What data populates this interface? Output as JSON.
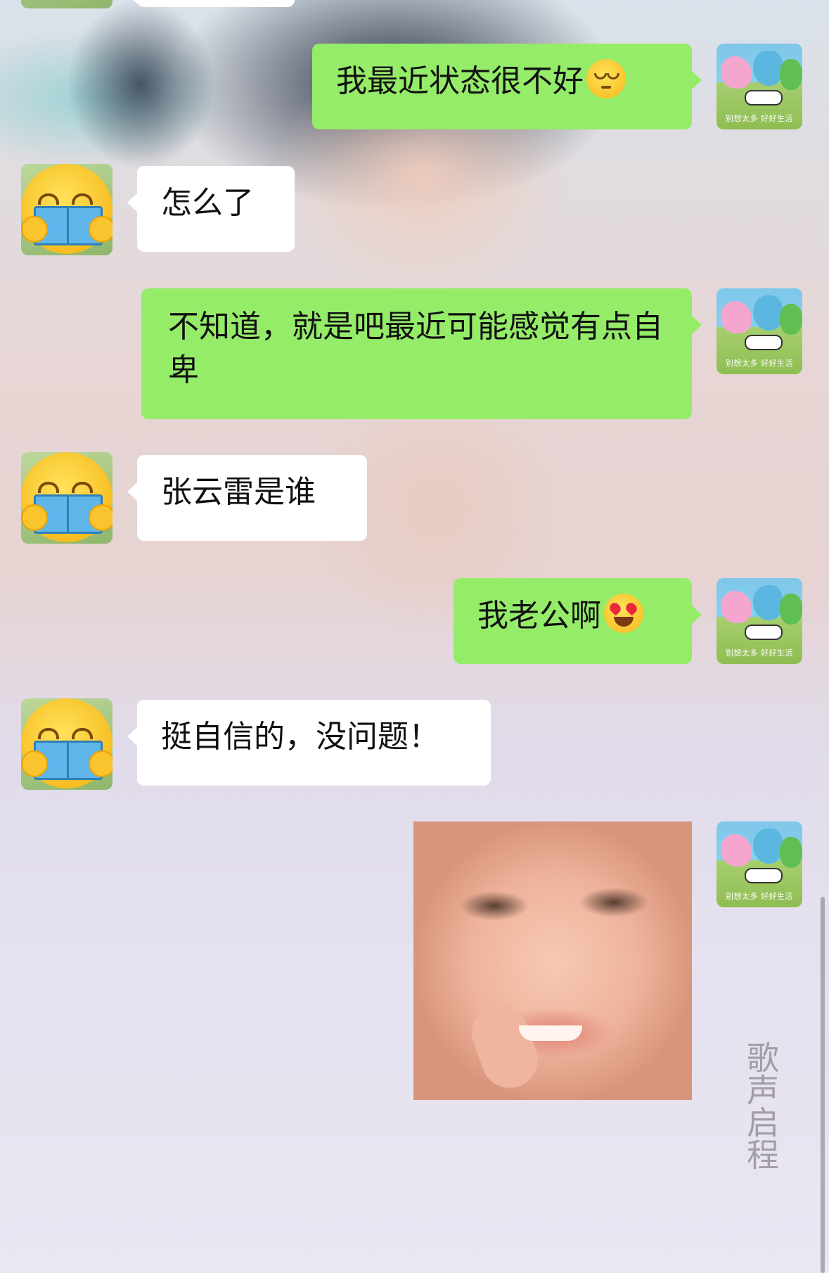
{
  "messages": [
    {
      "side": "me",
      "text": "我最近状态很不好",
      "emoji": "pensive-face"
    },
    {
      "side": "them",
      "text": "怎么了"
    },
    {
      "side": "me",
      "text": "不知道，就是吧最近可能感觉有点自卑"
    },
    {
      "side": "them",
      "text": "张云雷是谁"
    },
    {
      "side": "me",
      "text": "我老公啊",
      "emoji": "heart-eyes-face"
    },
    {
      "side": "them",
      "text": "挺自信的，没问题！"
    },
    {
      "side": "me",
      "type": "image",
      "image": "smiling-toddler-sticker"
    }
  ],
  "my_avatar": {
    "caption": "别想太多 好好生活"
  },
  "their_avatar": {
    "icon": "reading-emoji-icon"
  },
  "background_watermark": "歌声启程",
  "colors": {
    "my_bubble": "#95ec69",
    "their_bubble": "#ffffff"
  }
}
